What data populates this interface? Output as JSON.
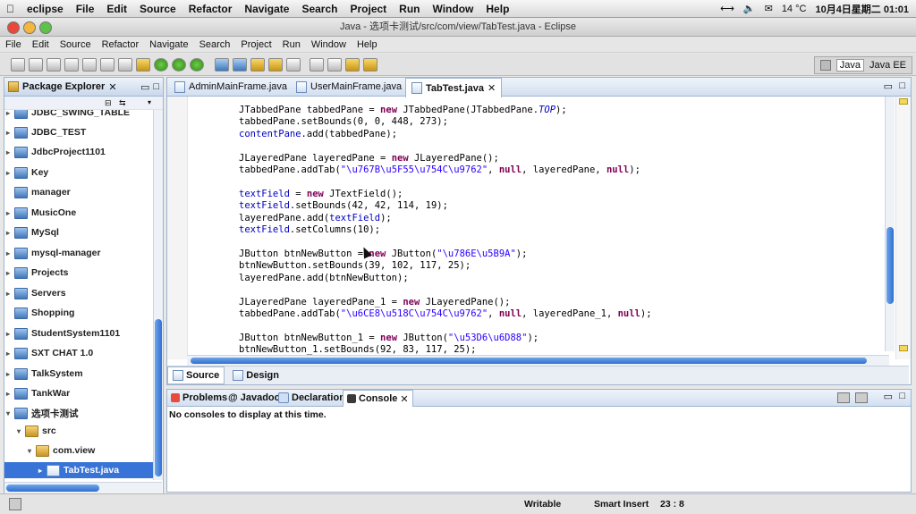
{
  "mac_menubar": {
    "app": "eclipse",
    "items": [
      "File",
      "Edit",
      "Source",
      "Refactor",
      "Navigate",
      "Search",
      "Project",
      "Run",
      "Window",
      "Help"
    ],
    "temperature": "14 °C",
    "datetime": "10月4日星期二 01:01"
  },
  "window": {
    "title": "Java - 选项卡测试/src/com/view/TabTest.java - Eclipse"
  },
  "app_menu": [
    "File",
    "Edit",
    "Source",
    "Refactor",
    "Navigate",
    "Search",
    "Project",
    "Run",
    "Window",
    "Help"
  ],
  "perspectives": [
    "Java",
    "Java EE"
  ],
  "package_explorer": {
    "title": "Package Explorer",
    "items": [
      {
        "label": "JDBC_SWING_TABLE",
        "type": "project",
        "arrow": "▸"
      },
      {
        "label": "JDBC_TEST",
        "type": "project",
        "arrow": "▸"
      },
      {
        "label": "JdbcProject1101",
        "type": "project",
        "arrow": "▸"
      },
      {
        "label": "Key",
        "type": "project",
        "arrow": "▸"
      },
      {
        "label": "manager",
        "type": "project",
        "arrow": ""
      },
      {
        "label": "MusicOne",
        "type": "project",
        "arrow": "▸"
      },
      {
        "label": "MySql",
        "type": "project",
        "arrow": "▸"
      },
      {
        "label": "mysql-manager",
        "type": "project",
        "arrow": "▸"
      },
      {
        "label": "Projects",
        "type": "project",
        "arrow": "▸"
      },
      {
        "label": "Servers",
        "type": "project",
        "arrow": "▸"
      },
      {
        "label": "Shopping",
        "type": "project",
        "arrow": ""
      },
      {
        "label": "StudentSystem1101",
        "type": "project",
        "arrow": "▸"
      },
      {
        "label": "SXT CHAT 1.0",
        "type": "project",
        "arrow": "▸"
      },
      {
        "label": "TalkSystem",
        "type": "project",
        "arrow": "▸"
      },
      {
        "label": "TankWar",
        "type": "project",
        "arrow": "▸"
      },
      {
        "label": "选项卡测试",
        "type": "project",
        "arrow": "▾"
      },
      {
        "label": "src",
        "type": "pkg",
        "arrow": "▾"
      },
      {
        "label": "com.view",
        "type": "pkg",
        "arrow": "▾"
      },
      {
        "label": "TabTest.java",
        "type": "file",
        "arrow": "▸",
        "selected": true
      }
    ]
  },
  "editor": {
    "tabs": [
      "AdminMainFrame.java",
      "UserMainFrame.java",
      "TabTest.java"
    ],
    "active_tab": "TabTest.java",
    "bottom_tabs": [
      "Source",
      "Design"
    ]
  },
  "console": {
    "tabs": [
      "Problems",
      "Javadoc",
      "Declaration",
      "Console"
    ],
    "message": "No consoles to display at this time."
  },
  "status": {
    "mode": "Writable",
    "insert": "Smart Insert",
    "position": "23 : 8"
  }
}
